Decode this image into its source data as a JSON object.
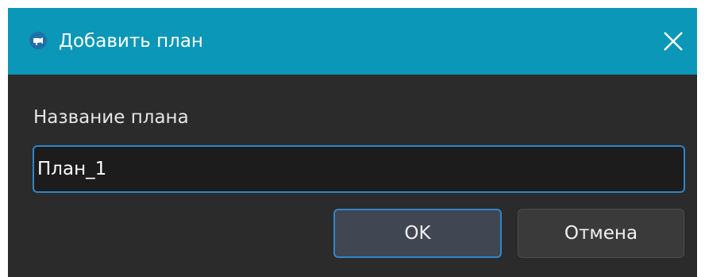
{
  "dialog": {
    "title": "Добавить план",
    "close_icon": "close-icon",
    "app_icon": "camera-icon"
  },
  "form": {
    "label": "Название плана",
    "value": "План_1"
  },
  "buttons": {
    "ok_label": "OK",
    "cancel_label": "Отмена"
  },
  "colors": {
    "titlebar": "#0a97b8",
    "background": "#2b2b2b",
    "focus_border": "#2f86c8"
  }
}
